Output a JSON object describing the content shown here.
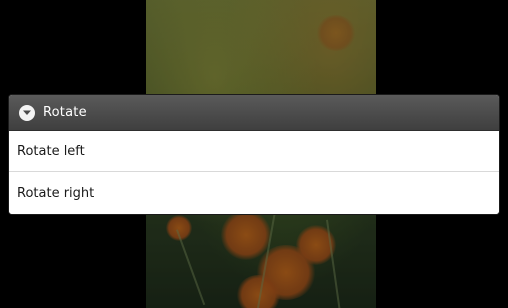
{
  "background": {
    "image": "flower-photo"
  },
  "dialog": {
    "title": "Rotate",
    "title_icon": "chevron-down-circle-icon",
    "items": [
      {
        "label": "Rotate left"
      },
      {
        "label": "Rotate right"
      }
    ]
  },
  "colors": {
    "title_bar": "#4a4a4a",
    "menu_bg": "#ffffff",
    "screen_bg": "#000000"
  }
}
